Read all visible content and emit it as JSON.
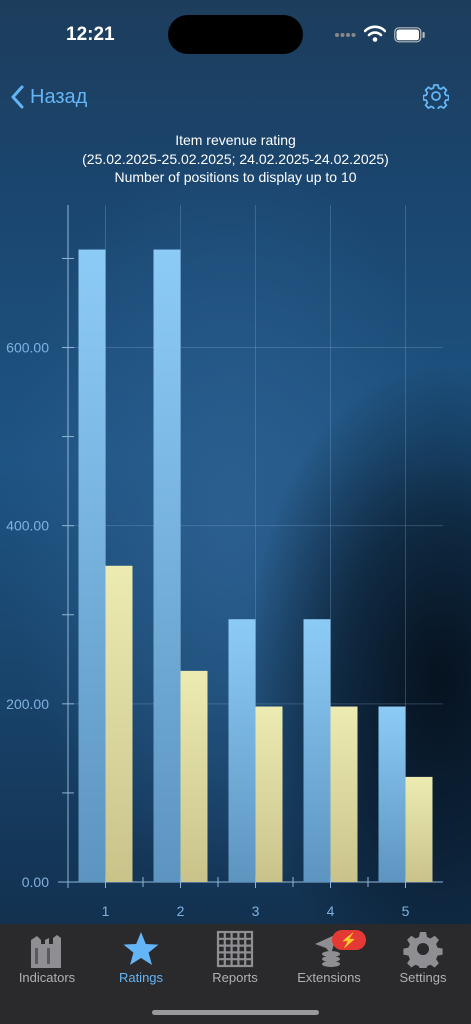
{
  "status": {
    "time": "12:21"
  },
  "nav": {
    "back_label": "Назад"
  },
  "chart_header": {
    "line1": "Item revenue rating",
    "line2": "(25.02.2025-25.02.2025; 24.02.2025-24.02.2025)",
    "line3": "Number of positions to display up to 10"
  },
  "chart_data": {
    "type": "bar",
    "title": "Item revenue rating",
    "categories": [
      "1",
      "2",
      "3",
      "4",
      "5"
    ],
    "series": [
      {
        "values": [
          710,
          710,
          295,
          295,
          197
        ],
        "color": "#82c4f4"
      },
      {
        "values": [
          355,
          237,
          197,
          197,
          118
        ],
        "color": "#e8e6a6"
      }
    ],
    "ylim": [
      0,
      760
    ],
    "yticks": [
      0,
      200,
      400,
      600
    ],
    "ytick_labels": [
      "0.00",
      "200.00",
      "400.00",
      "600.00"
    ],
    "grid": true,
    "xlabel": "",
    "ylabel": ""
  },
  "tabbar": {
    "items": [
      {
        "label": "Indicators",
        "icon": "indicators-icon",
        "active": false
      },
      {
        "label": "Ratings",
        "icon": "star-icon",
        "active": true
      },
      {
        "label": "Reports",
        "icon": "grid-icon",
        "active": false
      },
      {
        "label": "Extensions",
        "icon": "extensions-icon",
        "active": false
      },
      {
        "label": "Settings",
        "icon": "gear-icon",
        "active": false
      }
    ],
    "badge": "⚡"
  },
  "colors": {
    "accent": "#64b5f6",
    "tabbar_bg": "#2a2a2c"
  }
}
